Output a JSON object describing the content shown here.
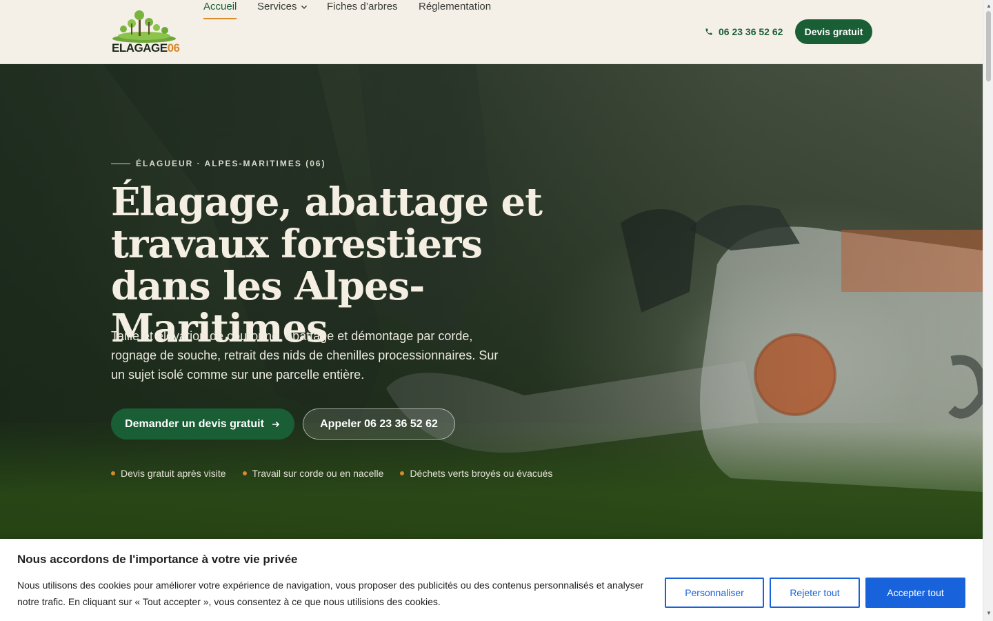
{
  "header": {
    "logo": {
      "text": "ELAGAGE",
      "number": "06"
    },
    "nav": [
      {
        "label": "Accueil",
        "active": true
      },
      {
        "label": "Services",
        "has_dropdown": true
      },
      {
        "label": "Fiches d’arbres"
      },
      {
        "label": "Réglementation"
      }
    ],
    "phone": "06 23 36 52 62",
    "cta": "Devis gratuit"
  },
  "hero": {
    "eyebrow": "ÉLAGUEUR · ALPES-MARITIMES (06)",
    "title": "Élagage, abattage et travaux forestiers dans les Alpes-Maritimes",
    "subtitle": "Taille et élévation de couronne, abattage et démontage par corde, rognage de souche, retrait des nids de chenilles processionnaires. Sur un sujet isolé comme sur une parcelle entière.",
    "cta_primary": "Demander un devis gratuit",
    "cta_secondary": "Appeler 06 23 36 52 62",
    "bullets": [
      "Devis gratuit après visite",
      "Travail sur corde ou en nacelle",
      "Déchets verts broyés ou évacués"
    ]
  },
  "cookie_banner": {
    "title": "Nous accordons de l'importance à votre vie privée",
    "text": "Nous utilisons des cookies pour améliorer votre expérience de navigation, vous proposer des publicités ou des contenus personnalisés et analyser notre trafic. En cliquant sur « Tout accepter », vous consentez à ce que nous utilisions des cookies.",
    "buttons": {
      "customize": "Personnaliser",
      "reject": "Rejeter tout",
      "accept": "Accepter tout"
    }
  },
  "colors": {
    "brand_green": "#1a5e36",
    "accent_orange": "#d98a2b",
    "header_bg": "#f4f0e8",
    "cookie_blue": "#1863dc"
  },
  "icons": [
    "logo-tree-icon",
    "chevron-down-icon",
    "phone-icon",
    "arrow-right-icon"
  ]
}
